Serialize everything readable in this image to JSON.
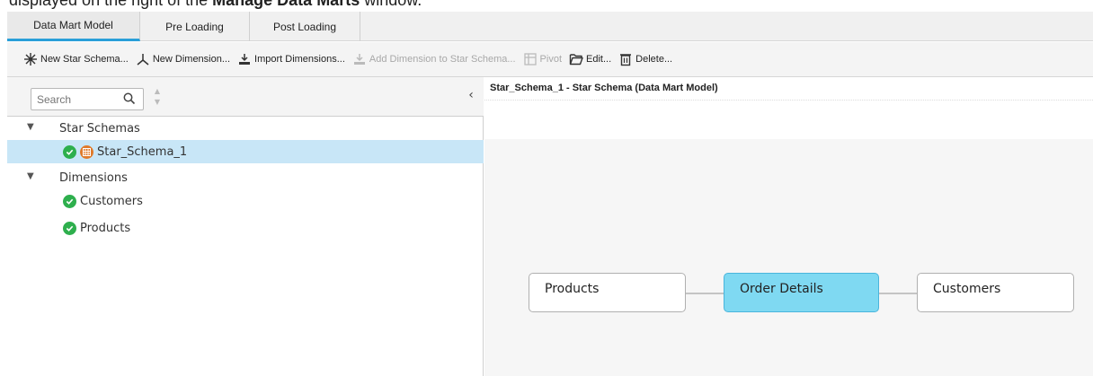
{
  "caption": {
    "prefix": "displayed on the right of the ",
    "bold": "Manage Data Marts",
    "suffix": " window."
  },
  "tabs": [
    {
      "label": "Data Mart Model",
      "active": true
    },
    {
      "label": "Pre Loading",
      "active": false
    },
    {
      "label": "Post Loading",
      "active": false
    }
  ],
  "toolbar": {
    "new_star_schema": "New Star Schema...",
    "new_dimension": "New Dimension...",
    "import_dimensions": "Import Dimensions...",
    "add_dimension": "Add Dimension to Star Schema...",
    "pivot": "Pivot",
    "edit": "Edit...",
    "delete": "Delete..."
  },
  "search": {
    "placeholder": "Search"
  },
  "tree": {
    "star_schemas_label": "Star Schemas",
    "star_schema_1": "Star_Schema_1",
    "dimensions_label": "Dimensions",
    "dimension_customers": "Customers",
    "dimension_products": "Products"
  },
  "diagram": {
    "title": "Star_Schema_1 - Star Schema (Data Mart Model)",
    "products": "Products",
    "fact": "Order Details",
    "customers": "Customers"
  },
  "colors": {
    "accent": "#2a9fd8",
    "selected_row": "#c8e6f7",
    "fact_fill": "#7fd9f2",
    "status_ok": "#2eaf4d",
    "schema_icon": "#e07a2a"
  }
}
